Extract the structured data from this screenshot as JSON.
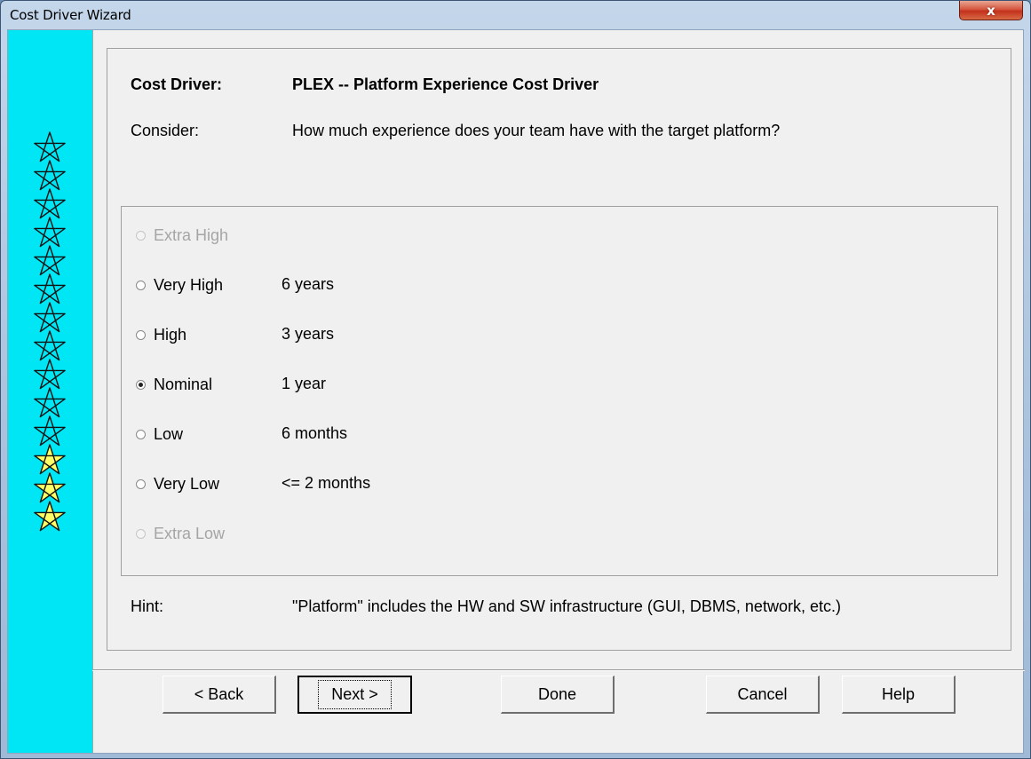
{
  "window": {
    "title": "Cost Driver Wizard",
    "close_label": "x"
  },
  "stars": {
    "count": 14,
    "outline_count": 11,
    "filled_count": 3,
    "outline_color": "#00e6f5",
    "filled_color": "#ffff66"
  },
  "header": {
    "cost_driver_label": "Cost Driver:",
    "cost_driver_value": "PLEX -- Platform Experience Cost Driver",
    "consider_label": "Consider:",
    "consider_value": "How much experience does your team have with the target platform?"
  },
  "options": [
    {
      "label": "Extra High",
      "desc": "",
      "enabled": false,
      "checked": false
    },
    {
      "label": "Very High",
      "desc": "6 years",
      "enabled": true,
      "checked": false
    },
    {
      "label": "High",
      "desc": "3 years",
      "enabled": true,
      "checked": false
    },
    {
      "label": "Nominal",
      "desc": "1 year",
      "enabled": true,
      "checked": true
    },
    {
      "label": "Low",
      "desc": "6 months",
      "enabled": true,
      "checked": false
    },
    {
      "label": "Very Low",
      "desc": "<= 2 months",
      "enabled": true,
      "checked": false
    },
    {
      "label": "Extra Low",
      "desc": "",
      "enabled": false,
      "checked": false
    }
  ],
  "hint": {
    "label": "Hint:",
    "value": "\"Platform\" includes the HW and SW infrastructure (GUI, DBMS, network, etc.)"
  },
  "buttons": {
    "back": "< Back",
    "next": "Next >",
    "done": "Done",
    "cancel": "Cancel",
    "help": "Help"
  }
}
